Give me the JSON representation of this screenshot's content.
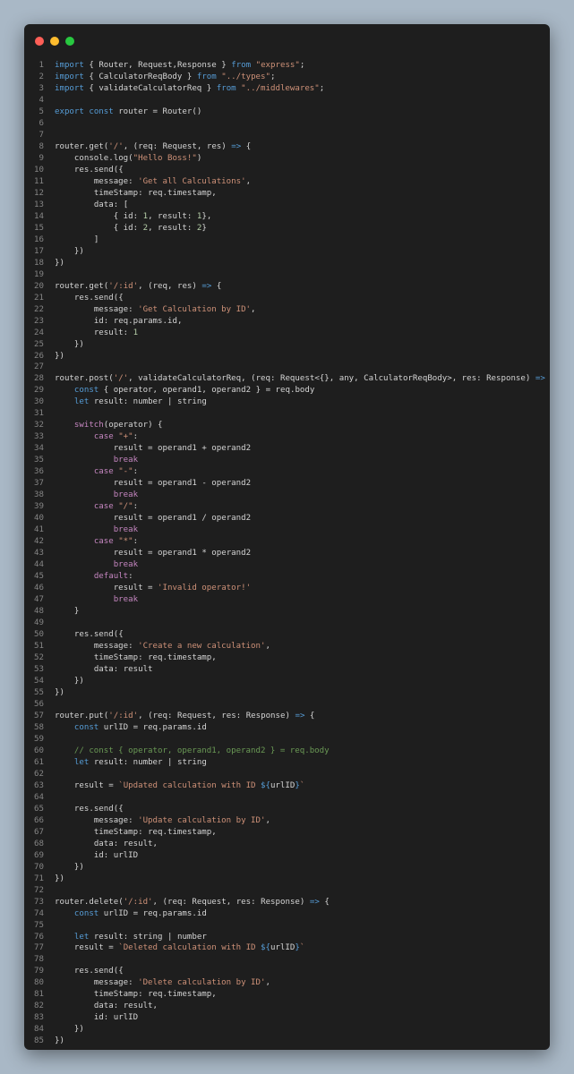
{
  "window": {
    "controls": [
      "close",
      "minimize",
      "maximize"
    ]
  },
  "code": {
    "language": "typescript",
    "lines": [
      {
        "n": "1",
        "text": "import { Router, Request,Response } from \"express\";"
      },
      {
        "n": "2",
        "text": "import { CalculatorReqBody } from \"../types\";"
      },
      {
        "n": "3",
        "text": "import { validateCalculatorReq } from \"../middlewares\";"
      },
      {
        "n": "4",
        "text": ""
      },
      {
        "n": "5",
        "text": "export const router = Router()"
      },
      {
        "n": "6",
        "text": ""
      },
      {
        "n": "7",
        "text": ""
      },
      {
        "n": "8",
        "text": "router.get('/', (req: Request, res) => {"
      },
      {
        "n": "9",
        "text": "    console.log(\"Hello Boss!\")"
      },
      {
        "n": "10",
        "text": "    res.send({"
      },
      {
        "n": "11",
        "text": "        message: 'Get all Calculations',"
      },
      {
        "n": "12",
        "text": "        timeStamp: req.timestamp,"
      },
      {
        "n": "13",
        "text": "        data: ["
      },
      {
        "n": "14",
        "text": "            { id: 1, result: 1},"
      },
      {
        "n": "15",
        "text": "            { id: 2, result: 2}"
      },
      {
        "n": "16",
        "text": "        ]"
      },
      {
        "n": "17",
        "text": "    })"
      },
      {
        "n": "18",
        "text": "})"
      },
      {
        "n": "19",
        "text": ""
      },
      {
        "n": "20",
        "text": "router.get('/:id', (req, res) => {"
      },
      {
        "n": "21",
        "text": "    res.send({"
      },
      {
        "n": "22",
        "text": "        message: 'Get Calculation by ID',"
      },
      {
        "n": "23",
        "text": "        id: req.params.id,"
      },
      {
        "n": "24",
        "text": "        result: 1"
      },
      {
        "n": "25",
        "text": "    })"
      },
      {
        "n": "26",
        "text": "})"
      },
      {
        "n": "27",
        "text": ""
      },
      {
        "n": "28",
        "text": "router.post('/', validateCalculatorReq, (req: Request<{}, any, CalculatorReqBody>, res: Response) => {"
      },
      {
        "n": "29",
        "text": "    const { operator, operand1, operand2 } = req.body"
      },
      {
        "n": "30",
        "text": "    let result: number | string"
      },
      {
        "n": "31",
        "text": ""
      },
      {
        "n": "32",
        "text": "    switch(operator) {"
      },
      {
        "n": "33",
        "text": "        case \"+\":"
      },
      {
        "n": "34",
        "text": "            result = operand1 + operand2"
      },
      {
        "n": "35",
        "text": "            break"
      },
      {
        "n": "36",
        "text": "        case \"-\":"
      },
      {
        "n": "37",
        "text": "            result = operand1 - operand2"
      },
      {
        "n": "38",
        "text": "            break"
      },
      {
        "n": "39",
        "text": "        case \"/\":"
      },
      {
        "n": "40",
        "text": "            result = operand1 / operand2"
      },
      {
        "n": "41",
        "text": "            break"
      },
      {
        "n": "42",
        "text": "        case \"*\":"
      },
      {
        "n": "43",
        "text": "            result = operand1 * operand2"
      },
      {
        "n": "44",
        "text": "            break"
      },
      {
        "n": "45",
        "text": "        default:"
      },
      {
        "n": "46",
        "text": "            result = 'Invalid operator!'"
      },
      {
        "n": "47",
        "text": "            break"
      },
      {
        "n": "48",
        "text": "    }"
      },
      {
        "n": "49",
        "text": ""
      },
      {
        "n": "50",
        "text": "    res.send({"
      },
      {
        "n": "51",
        "text": "        message: 'Create a new calculation',"
      },
      {
        "n": "52",
        "text": "        timeStamp: req.timestamp,"
      },
      {
        "n": "53",
        "text": "        data: result"
      },
      {
        "n": "54",
        "text": "    })"
      },
      {
        "n": "55",
        "text": "})"
      },
      {
        "n": "56",
        "text": ""
      },
      {
        "n": "57",
        "text": "router.put('/:id', (req: Request, res: Response) => {"
      },
      {
        "n": "58",
        "text": "    const urlID = req.params.id"
      },
      {
        "n": "59",
        "text": ""
      },
      {
        "n": "60",
        "text": "    // const { operator, operand1, operand2 } = req.body"
      },
      {
        "n": "61",
        "text": "    let result: number | string"
      },
      {
        "n": "62",
        "text": ""
      },
      {
        "n": "63",
        "text": "    result = `Updated calculation with ID ${urlID}`"
      },
      {
        "n": "64",
        "text": ""
      },
      {
        "n": "65",
        "text": "    res.send({"
      },
      {
        "n": "66",
        "text": "        message: 'Update calculation by ID',"
      },
      {
        "n": "67",
        "text": "        timeStamp: req.timestamp,"
      },
      {
        "n": "68",
        "text": "        data: result,"
      },
      {
        "n": "69",
        "text": "        id: urlID"
      },
      {
        "n": "70",
        "text": "    })"
      },
      {
        "n": "71",
        "text": "})"
      },
      {
        "n": "72",
        "text": ""
      },
      {
        "n": "73",
        "text": "router.delete('/:id', (req: Request, res: Response) => {"
      },
      {
        "n": "74",
        "text": "    const urlID = req.params.id"
      },
      {
        "n": "75",
        "text": ""
      },
      {
        "n": "76",
        "text": "    let result: string | number"
      },
      {
        "n": "77",
        "text": "    result = `Deleted calculation with ID ${urlID}`"
      },
      {
        "n": "78",
        "text": ""
      },
      {
        "n": "79",
        "text": "    res.send({"
      },
      {
        "n": "80",
        "text": "        message: 'Delete calculation by ID',"
      },
      {
        "n": "81",
        "text": "        timeStamp: req.timestamp,"
      },
      {
        "n": "82",
        "text": "        data: result,"
      },
      {
        "n": "83",
        "text": "        id: urlID"
      },
      {
        "n": "84",
        "text": "    })"
      },
      {
        "n": "85",
        "text": "})"
      }
    ]
  },
  "colors": {
    "background": "#a9b8c6",
    "editor": "#1e1e1e",
    "keyword": "#569cd6",
    "control": "#c586c0",
    "string": "#ce9178",
    "number": "#b5cea8",
    "comment": "#6a9955",
    "text": "#d4d4d4",
    "line_number": "#858585"
  }
}
